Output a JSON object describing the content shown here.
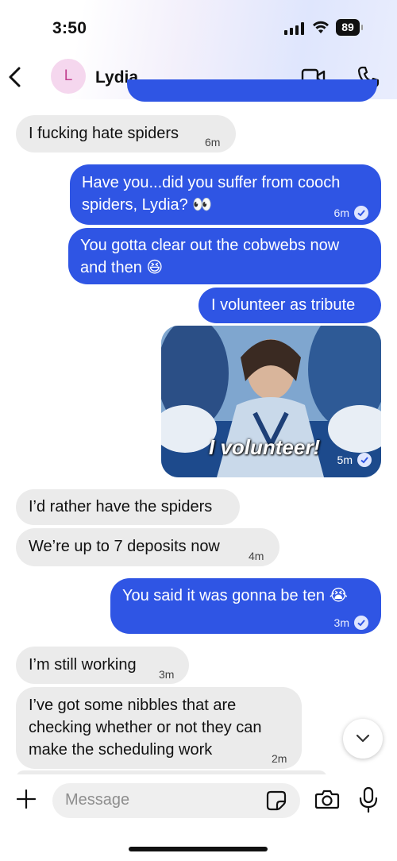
{
  "status_bar": {
    "time": "3:50",
    "battery": "89"
  },
  "header": {
    "avatar_letter": "L",
    "contact_name": "Lydia"
  },
  "messages": {
    "m1": {
      "text": "I fucking hate spiders",
      "time": "6m"
    },
    "m2": {
      "line1": "Have you...did you suffer from cooch",
      "line2": "spiders, Lydia? 👀",
      "time": "6m"
    },
    "m3": {
      "line1": "You gotta clear out the cobwebs now",
      "line2": "and then 😆"
    },
    "m4": {
      "text": "I volunteer as tribute"
    },
    "m5": {
      "caption": "I volunteer!",
      "time": "5m"
    },
    "m6": {
      "text": "I’d rather have the spiders"
    },
    "m7": {
      "text": "We’re up to 7 deposits now",
      "time": "4m"
    },
    "m8": {
      "text": "You said it was gonna be ten 😭",
      "time": "3m"
    },
    "m9": {
      "text": "I’m still working",
      "time": "3m"
    },
    "m10": {
      "line1": "I’ve got some nibbles that are",
      "line2": "checking whether or not they can",
      "line3": "make the scheduling work",
      "time": "2m"
    }
  },
  "composer": {
    "placeholder": "Message"
  },
  "colors": {
    "outgoing": "#2f55e4",
    "incoming": "#ebebeb",
    "avatar_bg": "#f5d7ee"
  }
}
